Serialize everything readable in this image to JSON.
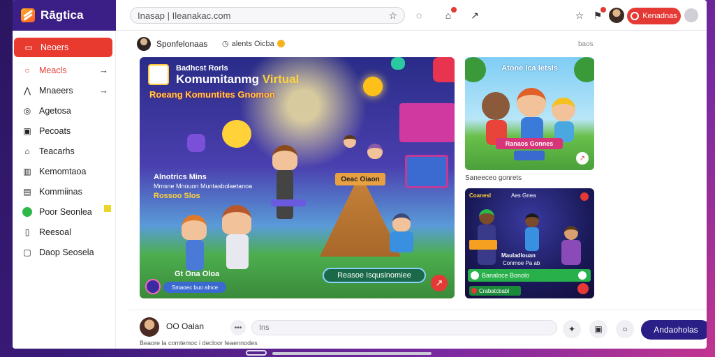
{
  "app": {
    "name": "Rāgtica"
  },
  "topbar": {
    "url": "Inasap | Ileanakac.com",
    "pill_label": "Kenadnas"
  },
  "sidebar": {
    "items": [
      {
        "label": "Neoers",
        "icon": "calendar-icon",
        "active": true
      },
      {
        "label": "Meacls",
        "icon": "search-icon",
        "arrow": true
      },
      {
        "label": "Mnaeers",
        "icon": "people-icon",
        "arrow": true
      },
      {
        "label": "Agetosa",
        "icon": "chat-icon"
      },
      {
        "label": "Pecoats",
        "icon": "video-icon"
      },
      {
        "label": "Teacarhs",
        "icon": "lock-icon"
      },
      {
        "label": "Kemomtaoa",
        "icon": "chart-icon"
      },
      {
        "label": "Kommiinas",
        "icon": "grid-icon"
      },
      {
        "label": "Poor Seonlea",
        "icon": "globe-icon"
      },
      {
        "label": "Reesoal",
        "icon": "book-icon"
      },
      {
        "label": "Daop Seosela",
        "icon": "phone-icon"
      }
    ]
  },
  "feed": {
    "author": "Sponfelonaas",
    "subtitle": "alents Oicba",
    "more": "baos"
  },
  "main_card": {
    "small": "Badhcst Rorls",
    "title": "Komumitanmg",
    "title_tag": "Virtual",
    "subtitle": "Roeang Komuntites Gnomon",
    "block1": "Alnotrics Mins",
    "block2": "Mmsne Mnouon Muntasbolaetanoa",
    "block3": "Rossoo Slos",
    "tent_sign": "Oeac Oiaon",
    "cta": "Reasoe Isqusinomiee",
    "bottom_label": "Gt Ona Oloa",
    "pill_left": "Smaoec buo alnce"
  },
  "right_card_top": {
    "title": "Atone lca letsls",
    "banner": "Ranaos Gonnes",
    "caption": "Saneeceo gonrets"
  },
  "right_card_bottom": {
    "top_left": "Coanesl",
    "top_center": "Aes Gnea",
    "mid1": "Mauladlouan",
    "mid2": "Conmoe Pa ab",
    "green_bar": "Banaloce Bonolo",
    "bottom": "Crabatcbabl"
  },
  "composer": {
    "name": "OO Oalan",
    "placeholder": "Ins",
    "button": "Andaoholas",
    "footer": "Beaore la comtemoc i decloor feaennodes"
  }
}
